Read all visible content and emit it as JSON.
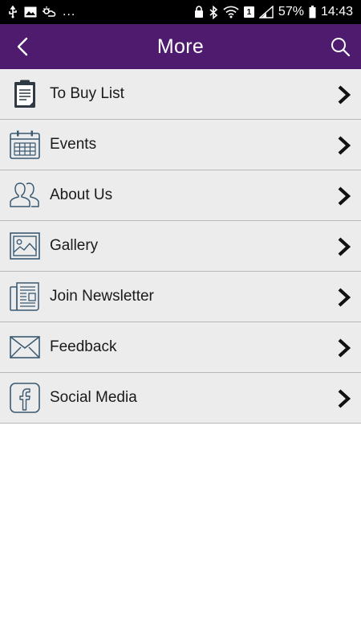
{
  "status_bar": {
    "battery_percent": "57%",
    "time": "14:43",
    "sim_slot": "1",
    "overflow": "...",
    "icons": [
      "usb-icon",
      "image-icon",
      "weather-icon",
      "lock-icon",
      "bluetooth-icon",
      "wifi-icon",
      "sim-icon",
      "signal-icon",
      "battery-icon"
    ]
  },
  "app_bar": {
    "title": "More",
    "background": "#4f1b6e"
  },
  "menu": {
    "items": [
      {
        "label": "To Buy List",
        "icon": "clipboard-icon"
      },
      {
        "label": "Events",
        "icon": "calendar-icon"
      },
      {
        "label": "About Us",
        "icon": "people-icon"
      },
      {
        "label": "Gallery",
        "icon": "picture-icon"
      },
      {
        "label": "Join Newsletter",
        "icon": "newspaper-icon"
      },
      {
        "label": "Feedback",
        "icon": "envelope-icon"
      },
      {
        "label": "Social Media",
        "icon": "facebook-icon"
      }
    ]
  }
}
